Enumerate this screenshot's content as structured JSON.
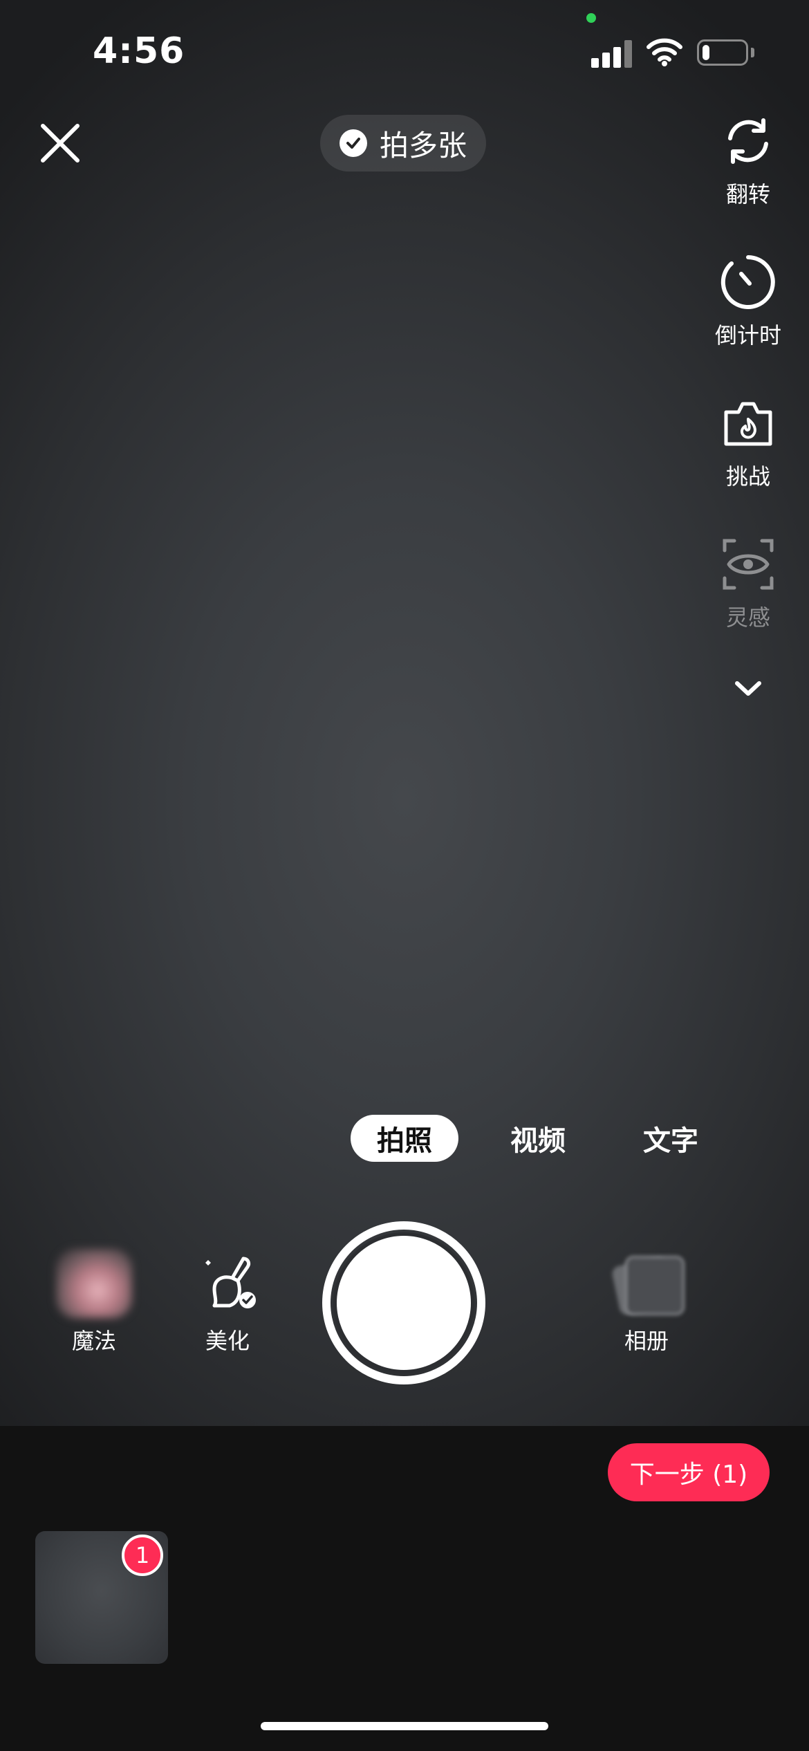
{
  "status_bar": {
    "time": "4:56",
    "battery_level": 0.18
  },
  "top_bar": {
    "close_icon": "close-icon",
    "multi_shot_label": "拍多张",
    "multi_shot_checked": true
  },
  "side_tools": [
    {
      "icon": "flip-camera-icon",
      "label": "翻转",
      "enabled": true
    },
    {
      "icon": "timer-icon",
      "label": "倒计时",
      "enabled": true
    },
    {
      "icon": "challenge-camera-icon",
      "label": "挑战",
      "enabled": true
    },
    {
      "icon": "inspiration-eye-icon",
      "label": "灵感",
      "enabled": false
    }
  ],
  "expand_icon": "chevron-down-icon",
  "modes": [
    {
      "label": "拍照",
      "active": true
    },
    {
      "label": "视频",
      "active": false
    },
    {
      "label": "文字",
      "active": false
    }
  ],
  "controls": {
    "magic_label": "魔法",
    "beauty_label": "美化",
    "album_label": "相册"
  },
  "next_button": {
    "label": "下一步 (1)"
  },
  "captured": {
    "count": "1"
  },
  "colors": {
    "accent": "#fe2c55",
    "privacy_indicator": "#30d158"
  }
}
